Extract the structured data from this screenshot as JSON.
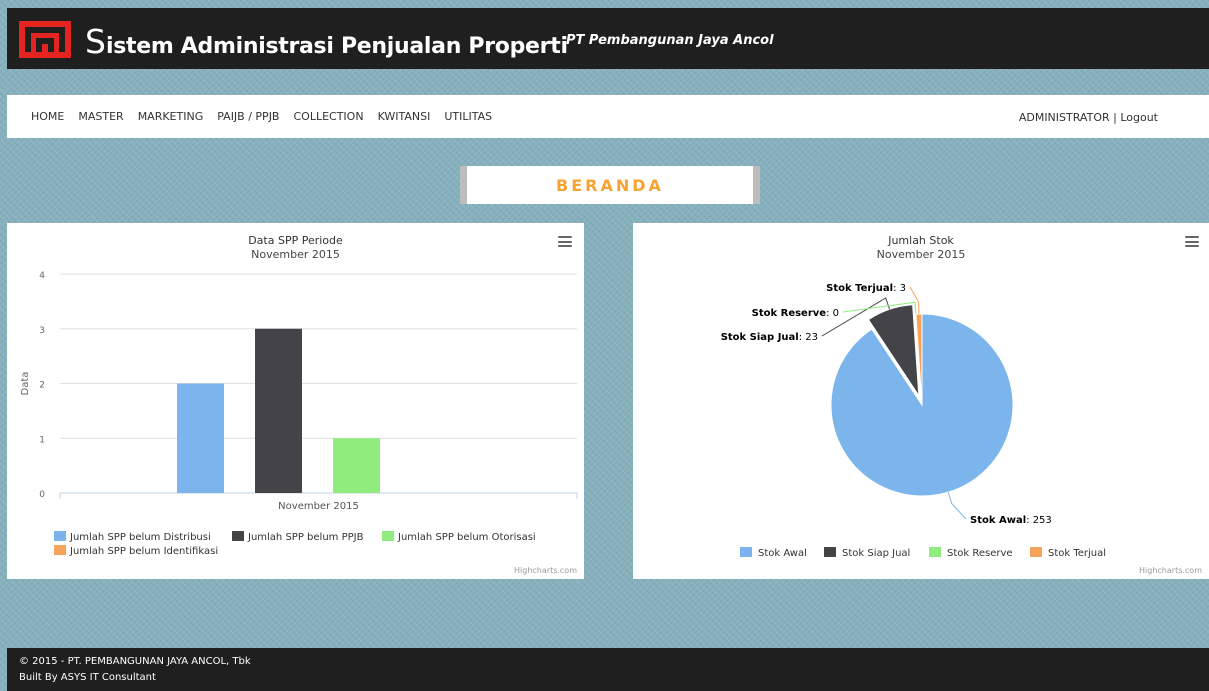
{
  "header": {
    "title_initial": "S",
    "title_rest": "istem Administrasi Penjualan Properti",
    "company": "PT Pembangunan Jaya Ancol",
    "colors": {
      "bar": "#1f1f1f",
      "logo": "#e52421"
    },
    "logo_icon": "company-logo-icon"
  },
  "nav": {
    "items": [
      "HOME",
      "MASTER",
      "MARKETING",
      "PAIJB / PPJB",
      "COLLECTION",
      "KWITANSI",
      "UTILITAS"
    ],
    "user": "ADMINISTRATOR",
    "separator": " | ",
    "logout": "Logout"
  },
  "page": {
    "heading": "BERANDA",
    "heading_color": "#f7a331"
  },
  "charts": {
    "left": {
      "menu_icon": "hamburger-menu-icon",
      "credits": "Highcharts.com"
    },
    "right": {
      "menu_icon": "hamburger-menu-icon",
      "credits": "Highcharts.com"
    }
  },
  "chart_data": [
    {
      "type": "bar",
      "title": "Data SPP Periode",
      "subtitle": "November 2015",
      "ylabel": "Data",
      "xlabel": "",
      "categories": [
        "November 2015"
      ],
      "ylim": [
        0,
        4
      ],
      "yticks": [
        0,
        1,
        2,
        3,
        4
      ],
      "grid": true,
      "legend_position": "bottom",
      "series": [
        {
          "name": "Jumlah SPP belum Distribusi",
          "values": [
            2
          ],
          "color": "#7cb5ec"
        },
        {
          "name": "Jumlah SPP belum PPJB",
          "values": [
            3
          ],
          "color": "#434348"
        },
        {
          "name": "Jumlah SPP belum Otorisasi",
          "values": [
            1
          ],
          "color": "#90ed7d"
        },
        {
          "name": "Jumlah SPP belum Identifikasi",
          "values": [
            0
          ],
          "color": "#f7a35c"
        }
      ]
    },
    {
      "type": "pie",
      "title": "Jumlah Stok",
      "subtitle": "November 2015",
      "legend_position": "bottom",
      "slices": [
        {
          "name": "Stok Awal",
          "value": 253,
          "color": "#7cb5ec",
          "sliced": false
        },
        {
          "name": "Stok Siap Jual",
          "value": 23,
          "color": "#434348",
          "sliced": true
        },
        {
          "name": "Stok Reserve",
          "value": 0,
          "color": "#90ed7d",
          "sliced": false
        },
        {
          "name": "Stok Terjual",
          "value": 3,
          "color": "#f7a35c",
          "sliced": false
        }
      ]
    }
  ],
  "footer": {
    "copyright": "© 2015 - PT. PEMBANGUNAN JAYA ANCOL, Tbk",
    "built_by": "Built By ASYS IT Consultant"
  }
}
